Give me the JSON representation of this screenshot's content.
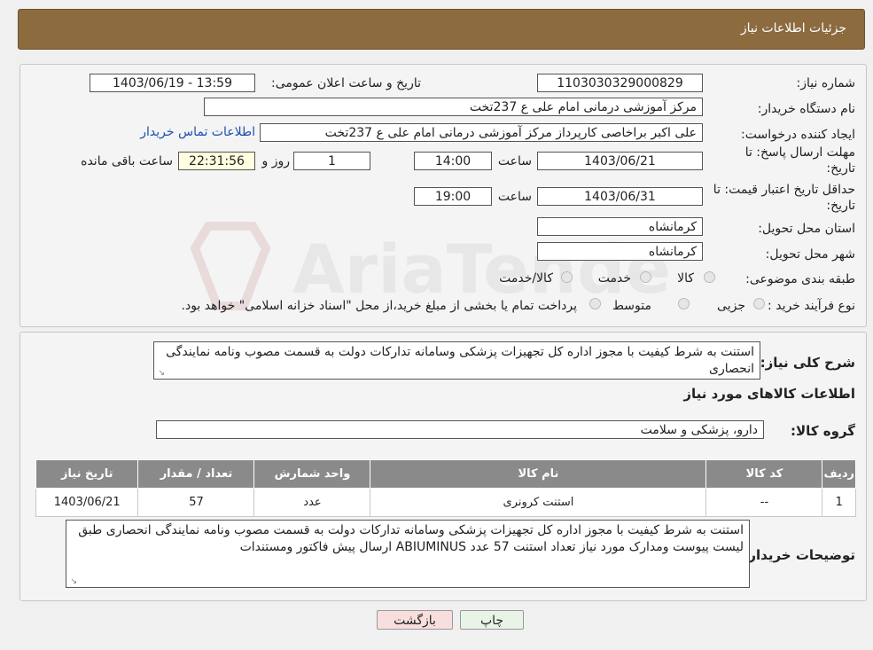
{
  "header": {
    "title": "جزئیات اطلاعات نیاز"
  },
  "fields": {
    "need_number_label": "شماره نیاز:",
    "need_number": "1103030329000829",
    "announce_label": "تاریخ و ساعت اعلان عمومی:",
    "announce_value": "1403/06/19 - 13:59",
    "buyer_org_label": "نام دستگاه خریدار:",
    "buyer_org": "مرکز آموزشی درمانی امام علی ع 237تخت",
    "requester_label": "ایجاد کننده درخواست:",
    "requester": "علی اکبر براخاصی کارپرداز  مرکز آموزشی درمانی امام علی ع 237تخت",
    "contact_link": "اطلاعات تماس خریدار",
    "deadline_label_1": "مهلت ارسال پاسخ: تا",
    "deadline_label_2": "تاریخ:",
    "deadline_date": "1403/06/21",
    "time_label": "ساعت",
    "deadline_time": "14:00",
    "days_value": "1",
    "days_label": "روز و",
    "remaining_time": "22:31:56",
    "remaining_label": "ساعت باقی مانده",
    "validity_label_1": "حداقل تاریخ اعتبار قیمت: تا",
    "validity_label_2": "تاریخ:",
    "validity_date": "1403/06/31",
    "validity_time": "19:00",
    "province_label": "استان محل تحویل:",
    "province": "کرمانشاه",
    "city_label": "شهر محل تحویل:",
    "city": "کرمانشاه",
    "category_label": "طبقه بندی موضوعی:",
    "category_options": [
      "کالا",
      "خدمت",
      "کالا/خدمت"
    ],
    "purchase_type_label": "نوع فرآیند خرید :",
    "purchase_options": [
      "جزیی",
      "متوسط"
    ],
    "purchase_note": "پرداخت تمام یا بخشی از مبلغ خرید،از محل \"اسناد خزانه اسلامی\" خواهد بود."
  },
  "description": {
    "label": "شرح کلی نیاز:",
    "text": "استنت به شرط کیفیت با مجوز اداره کل تجهیزات پزشکی وسامانه تدارکات دولت به قسمت مصوب ونامه نمایندگی انحصاری"
  },
  "goods": {
    "title": "اطلاعات کالاهای مورد نیاز",
    "group_label": "گروه کالا:",
    "group_value": "دارو، پزشکی و سلامت",
    "columns": [
      "ردیف",
      "کد کالا",
      "نام کالا",
      "واحد شمارش",
      "تعداد / مقدار",
      "تاریخ نیاز"
    ],
    "rows": [
      [
        "1",
        "--",
        "استنت کرونری",
        "عدد",
        "57",
        "1403/06/21"
      ]
    ]
  },
  "buyer_notes": {
    "label": "توضیحات خریدار:",
    "text": "استنت به شرط کیفیت با مجوز اداره کل تجهیزات پزشکی وسامانه تدارکات دولت به قسمت مصوب ونامه نمایندگی انحصاری طبق لیست پیوست ومدارک مورد نیاز تعداد استنت 57 عدد ABIUMINUS  ارسال پیش فاکتور ومستندات"
  },
  "buttons": {
    "print": "چاپ",
    "back": "بازگشت"
  },
  "watermark": {
    "text": "AriaTender.neT"
  },
  "colors": {
    "header": "#8c6b3f",
    "table_header": "#8a8a8a",
    "link": "#1a4fb0",
    "back_button": "#f9dede"
  }
}
